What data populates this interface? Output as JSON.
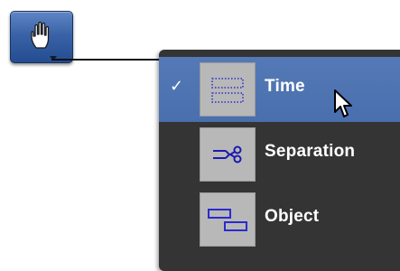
{
  "tool_button": {
    "icon": "grabber-hand-icon",
    "has_dropdown": true
  },
  "menu": {
    "items": [
      {
        "label": "Time",
        "icon": "time-grabber-icon",
        "checked": true,
        "highlighted": true
      },
      {
        "label": "Separation",
        "icon": "separation-grabber-icon",
        "checked": false,
        "highlighted": false
      },
      {
        "label": "Object",
        "icon": "object-grabber-icon",
        "checked": false,
        "highlighted": false
      }
    ],
    "check_mark": "✓"
  },
  "colors": {
    "button_blue": "#3a63a7",
    "menu_bg": "#343434",
    "highlight": "#4f74b2",
    "icon_blue": "#2a2ad0"
  }
}
